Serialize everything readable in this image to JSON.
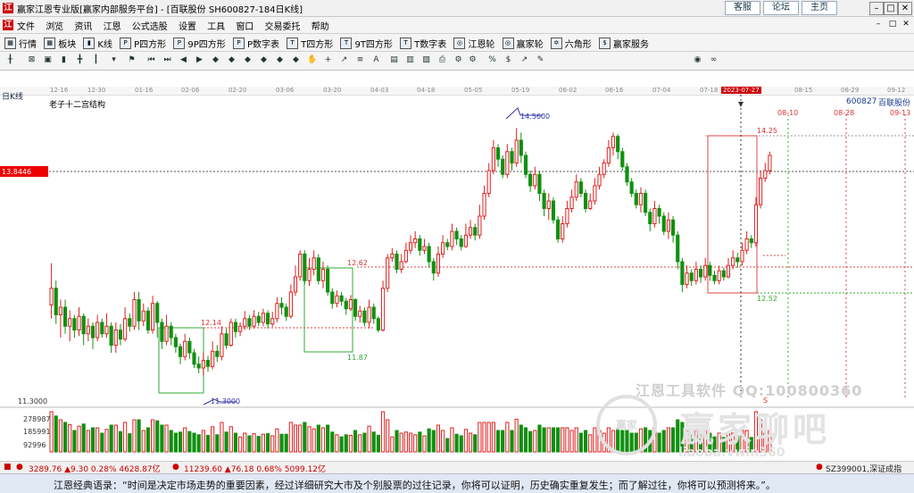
{
  "window": {
    "title": "赢家江恩专业版[赢家内部服务平台] - [百联股份  SH600827-184日K线]",
    "links": [
      "客服",
      "论坛",
      "主页"
    ],
    "win_min": "–",
    "win_max": "□",
    "win_close": "✕"
  },
  "menu": {
    "items": [
      "文件",
      "浏览",
      "资讯",
      "江恩",
      "公式选股",
      "设置",
      "工具",
      "窗口",
      "交易委托",
      "帮助"
    ]
  },
  "toolbar": {
    "items": [
      "行情",
      "板块",
      "K线",
      "P四方形",
      "9P四方形",
      "P数字表",
      "T四方形",
      "9T四方形",
      "T数字表",
      "江恩轮",
      "赢家轮",
      "六角形",
      "赢家服务"
    ]
  },
  "chart_header": {
    "period": "日K线",
    "indicator": "老子十二宫结构",
    "code": "600827",
    "name": "百联股份"
  },
  "date_axis": {
    "labels": [
      "12-16",
      "12-30",
      "01-16",
      "02-06",
      "02-20",
      "03-06",
      "03-20",
      "04-03",
      "04-18",
      "05-05",
      "05-19",
      "06-02",
      "06-16",
      "07-04",
      "07-18",
      "2023-07-27",
      "08-15",
      "08-29",
      "09-12"
    ],
    "highlight": "2023-07-27"
  },
  "projection_dates": [
    "08-10",
    "08-28",
    "09-13"
  ],
  "chart_data": {
    "type": "candlestick",
    "ylim": [
      11.0,
      15.0
    ],
    "candles": [
      [
        12.23,
        12.45,
        12.78,
        12.05
      ],
      [
        12.45,
        12.1,
        12.55,
        11.98
      ],
      [
        12.1,
        12.2,
        12.3,
        11.8
      ],
      [
        12.2,
        11.95,
        12.3,
        11.85
      ],
      [
        11.95,
        12.05,
        12.16,
        11.75
      ],
      [
        12.05,
        11.9,
        12.1,
        11.8
      ],
      [
        11.9,
        12.08,
        12.2,
        11.82
      ],
      [
        12.08,
        11.85,
        12.12,
        11.7
      ],
      [
        11.85,
        11.95,
        12.05,
        11.75
      ],
      [
        11.95,
        11.8,
        12.0,
        11.65
      ],
      [
        11.8,
        12.0,
        12.1,
        11.75
      ],
      [
        12.0,
        11.85,
        12.05,
        11.8
      ],
      [
        11.85,
        11.95,
        12.12,
        11.8
      ],
      [
        11.95,
        11.7,
        12.0,
        11.6
      ],
      [
        11.7,
        11.9,
        12.0,
        11.6
      ],
      [
        11.9,
        11.78,
        11.98,
        11.7
      ],
      [
        11.78,
        12.05,
        12.2,
        11.75
      ],
      [
        12.05,
        11.95,
        12.12,
        11.88
      ],
      [
        11.95,
        12.3,
        12.4,
        11.9
      ],
      [
        12.3,
        12.02,
        12.4,
        11.9
      ],
      [
        12.02,
        12.15,
        12.25,
        11.95
      ],
      [
        12.15,
        11.9,
        12.2,
        11.85
      ],
      [
        11.9,
        12.25,
        12.35,
        11.85
      ],
      [
        12.25,
        12.0,
        12.28,
        11.8
      ],
      [
        12.0,
        11.75,
        12.05,
        11.65
      ],
      [
        11.75,
        11.95,
        12.1,
        11.7
      ],
      [
        11.95,
        11.8,
        12.0,
        11.7
      ],
      [
        11.8,
        11.68,
        11.85,
        11.6
      ],
      [
        11.68,
        11.55,
        11.72,
        11.45
      ],
      [
        11.55,
        11.75,
        11.85,
        11.5
      ],
      [
        11.75,
        11.6,
        11.8,
        11.52
      ],
      [
        11.6,
        11.45,
        11.65,
        11.4
      ],
      [
        11.45,
        11.4,
        11.55,
        11.33
      ],
      [
        11.4,
        11.5,
        11.6,
        11.3
      ],
      [
        11.5,
        11.42,
        11.56,
        11.35
      ],
      [
        11.42,
        11.62,
        11.75,
        11.38
      ],
      [
        11.62,
        11.55,
        11.7,
        11.48
      ],
      [
        11.55,
        11.85,
        11.95,
        11.5
      ],
      [
        11.85,
        11.7,
        11.92,
        11.65
      ],
      [
        11.7,
        12.0,
        12.05,
        11.68
      ],
      [
        12.0,
        11.88,
        12.05,
        11.8
      ],
      [
        11.88,
        11.95,
        12.0,
        11.82
      ],
      [
        11.95,
        12.05,
        12.15,
        11.9
      ],
      [
        12.05,
        11.95,
        12.1,
        11.9
      ],
      [
        11.95,
        12.08,
        12.16,
        11.92
      ],
      [
        12.08,
        12.0,
        12.14,
        11.95
      ],
      [
        12.0,
        12.12,
        12.18,
        11.95
      ],
      [
        12.12,
        11.98,
        12.16,
        11.92
      ],
      [
        11.98,
        12.05,
        12.14,
        11.94
      ],
      [
        12.05,
        12.25,
        12.33,
        12.0
      ],
      [
        12.25,
        12.2,
        12.33,
        12.1
      ],
      [
        12.2,
        12.08,
        12.25,
        12.02
      ],
      [
        12.08,
        12.4,
        12.5,
        12.05
      ],
      [
        12.4,
        12.6,
        12.75,
        12.35
      ],
      [
        12.6,
        12.9,
        12.95,
        12.55
      ],
      [
        12.9,
        12.55,
        12.95,
        12.5
      ],
      [
        12.55,
        12.7,
        12.85,
        12.48
      ],
      [
        12.7,
        12.85,
        12.95,
        12.62
      ],
      [
        12.85,
        12.55,
        12.9,
        12.5
      ],
      [
        12.55,
        12.7,
        12.8,
        12.45
      ],
      [
        12.7,
        12.4,
        12.75,
        12.35
      ],
      [
        12.4,
        12.25,
        12.45,
        12.18
      ],
      [
        12.25,
        12.35,
        12.42,
        12.2
      ],
      [
        12.35,
        12.28,
        12.4,
        12.22
      ],
      [
        12.28,
        12.18,
        12.32,
        12.1
      ],
      [
        12.18,
        12.3,
        12.36,
        12.15
      ],
      [
        12.3,
        12.08,
        12.32,
        12.02
      ],
      [
        12.08,
        12.15,
        12.22,
        12.0
      ],
      [
        12.15,
        12.0,
        12.2,
        11.95
      ],
      [
        12.0,
        12.2,
        12.3,
        11.92
      ],
      [
        12.2,
        12.05,
        12.25,
        11.98
      ],
      [
        12.05,
        11.9,
        12.08,
        11.87
      ],
      [
        11.9,
        12.45,
        12.55,
        11.88
      ],
      [
        12.45,
        12.85,
        12.9,
        12.4
      ],
      [
        12.85,
        12.9,
        12.98,
        12.8
      ],
      [
        12.9,
        12.7,
        12.95,
        12.65
      ],
      [
        12.7,
        12.8,
        12.9,
        12.65
      ],
      [
        12.8,
        12.95,
        13.05,
        12.78
      ],
      [
        12.95,
        13.05,
        13.15,
        12.9
      ],
      [
        13.05,
        13.1,
        13.2,
        12.98
      ],
      [
        13.1,
        12.95,
        13.15,
        12.88
      ],
      [
        12.95,
        13.0,
        13.1,
        12.9
      ],
      [
        13.0,
        12.8,
        13.05,
        12.72
      ],
      [
        12.8,
        12.65,
        12.85,
        12.55
      ],
      [
        12.65,
        12.9,
        13.0,
        12.6
      ],
      [
        12.9,
        13.05,
        13.15,
        12.85
      ],
      [
        13.05,
        13.0,
        13.1,
        12.95
      ],
      [
        13.0,
        13.2,
        13.3,
        12.95
      ],
      [
        13.2,
        13.1,
        13.25,
        13.02
      ],
      [
        13.1,
        13.0,
        13.15,
        12.95
      ],
      [
        13.0,
        13.15,
        13.3,
        12.98
      ],
      [
        13.15,
        13.25,
        13.35,
        13.1
      ],
      [
        13.25,
        13.15,
        13.3,
        13.08
      ],
      [
        13.15,
        13.4,
        13.55,
        13.1
      ],
      [
        13.4,
        13.7,
        13.8,
        13.35
      ],
      [
        13.7,
        14.0,
        14.1,
        13.65
      ],
      [
        14.0,
        14.3,
        14.4,
        13.95
      ],
      [
        14.3,
        14.15,
        14.35,
        14.05
      ],
      [
        14.15,
        13.95,
        14.2,
        13.9
      ],
      [
        13.95,
        14.25,
        14.35,
        13.9
      ],
      [
        14.25,
        14.1,
        14.3,
        14.0
      ],
      [
        14.1,
        14.4,
        14.56,
        14.05
      ],
      [
        14.4,
        14.2,
        14.5,
        14.1
      ],
      [
        14.2,
        13.95,
        14.25,
        13.9
      ],
      [
        13.95,
        13.8,
        14.0,
        13.72
      ],
      [
        13.8,
        13.95,
        14.05,
        13.75
      ],
      [
        13.95,
        13.7,
        14.0,
        13.6
      ],
      [
        13.7,
        13.5,
        13.75,
        13.4
      ],
      [
        13.5,
        13.6,
        13.7,
        13.35
      ],
      [
        13.6,
        13.35,
        13.65,
        13.3
      ],
      [
        13.35,
        13.1,
        13.4,
        13.05
      ],
      [
        13.1,
        13.3,
        13.4,
        13.05
      ],
      [
        13.3,
        13.5,
        13.6,
        13.25
      ],
      [
        13.5,
        13.65,
        13.75,
        13.45
      ],
      [
        13.65,
        13.85,
        13.95,
        13.6
      ],
      [
        13.85,
        13.7,
        13.9,
        13.65
      ],
      [
        13.7,
        13.5,
        13.75,
        13.45
      ],
      [
        13.5,
        13.6,
        13.7,
        13.48
      ],
      [
        13.6,
        13.8,
        13.9,
        13.55
      ],
      [
        13.8,
        13.95,
        14.05,
        13.75
      ],
      [
        13.95,
        14.1,
        14.15,
        13.9
      ],
      [
        14.1,
        14.3,
        14.4,
        14.05
      ],
      [
        14.3,
        14.45,
        14.5,
        14.2
      ],
      [
        14.45,
        14.25,
        14.48,
        14.15
      ],
      [
        14.25,
        14.05,
        14.3,
        14.0
      ],
      [
        14.05,
        13.85,
        14.1,
        13.8
      ],
      [
        13.85,
        13.7,
        13.9,
        13.65
      ],
      [
        13.7,
        13.55,
        13.75,
        13.5
      ],
      [
        13.55,
        13.7,
        13.78,
        13.45
      ],
      [
        13.7,
        13.45,
        13.75,
        13.4
      ],
      [
        13.45,
        13.3,
        13.5,
        13.2
      ],
      [
        13.3,
        13.5,
        13.6,
        13.25
      ],
      [
        13.5,
        13.4,
        13.55,
        13.3
      ],
      [
        13.4,
        13.2,
        13.45,
        13.15
      ],
      [
        13.2,
        13.35,
        13.45,
        13.1
      ],
      [
        13.35,
        13.15,
        13.4,
        13.05
      ],
      [
        13.15,
        12.8,
        13.2,
        12.7
      ],
      [
        12.8,
        12.5,
        12.85,
        12.4
      ],
      [
        12.5,
        12.65,
        12.75,
        12.45
      ],
      [
        12.65,
        12.55,
        12.7,
        12.48
      ],
      [
        12.55,
        12.7,
        12.8,
        12.5
      ],
      [
        12.7,
        12.6,
        12.75,
        12.52
      ],
      [
        12.6,
        12.75,
        12.85,
        12.55
      ],
      [
        12.75,
        12.62,
        12.8,
        12.55
      ],
      [
        12.62,
        12.55,
        12.68,
        12.5
      ],
      [
        12.55,
        12.68,
        12.75,
        12.5
      ],
      [
        12.68,
        12.6,
        12.72,
        12.55
      ],
      [
        12.6,
        12.75,
        12.85,
        12.58
      ],
      [
        12.75,
        12.85,
        12.95,
        12.7
      ],
      [
        12.85,
        12.8,
        12.92,
        12.72
      ],
      [
        12.8,
        12.95,
        13.05,
        12.75
      ],
      [
        12.95,
        13.1,
        13.2,
        12.9
      ],
      [
        13.1,
        13.05,
        13.15,
        12.98
      ],
      [
        13.05,
        13.55,
        13.65,
        13.0
      ],
      [
        13.55,
        13.9,
        14.0,
        13.5
      ],
      [
        13.9,
        14.0,
        14.1,
        13.85
      ],
      [
        14.0,
        14.2,
        14.25,
        13.95
      ]
    ],
    "volume_axis": {
      "ticks": [
        "278987",
        "185991",
        "92996"
      ]
    },
    "price_labels": {
      "current": "13.8446",
      "low": "11.3000",
      "high": "14.5600",
      "level_1214": "12.14",
      "level_1187": "11.87",
      "level_1262": "12.62",
      "level_1425": "14.25",
      "level_1252": "12.52",
      "axis_low": "11.3000"
    },
    "markers": {
      "s_mark": "S"
    }
  },
  "status": {
    "idx1": "3289.76 ▲9.30 0.28% 4628.87亿",
    "idx2": "11239.60 ▲76.18 0.68% 5099.12亿",
    "idx3": "SZ399001,深证成指"
  },
  "quote": "江恩经典语录：“时间是决定市场走势的重要因素，经过详细研究大市及个别股票的过往记录，你将可以证明，历史确实重复发生；而了解过往，你将可以预测将来。”。",
  "watermark": {
    "line1": "江恩工具软件  QQ:100800360",
    "circle": "赢家",
    "big": "赢家聊吧",
    "site": "liaoba.vwin360"
  }
}
